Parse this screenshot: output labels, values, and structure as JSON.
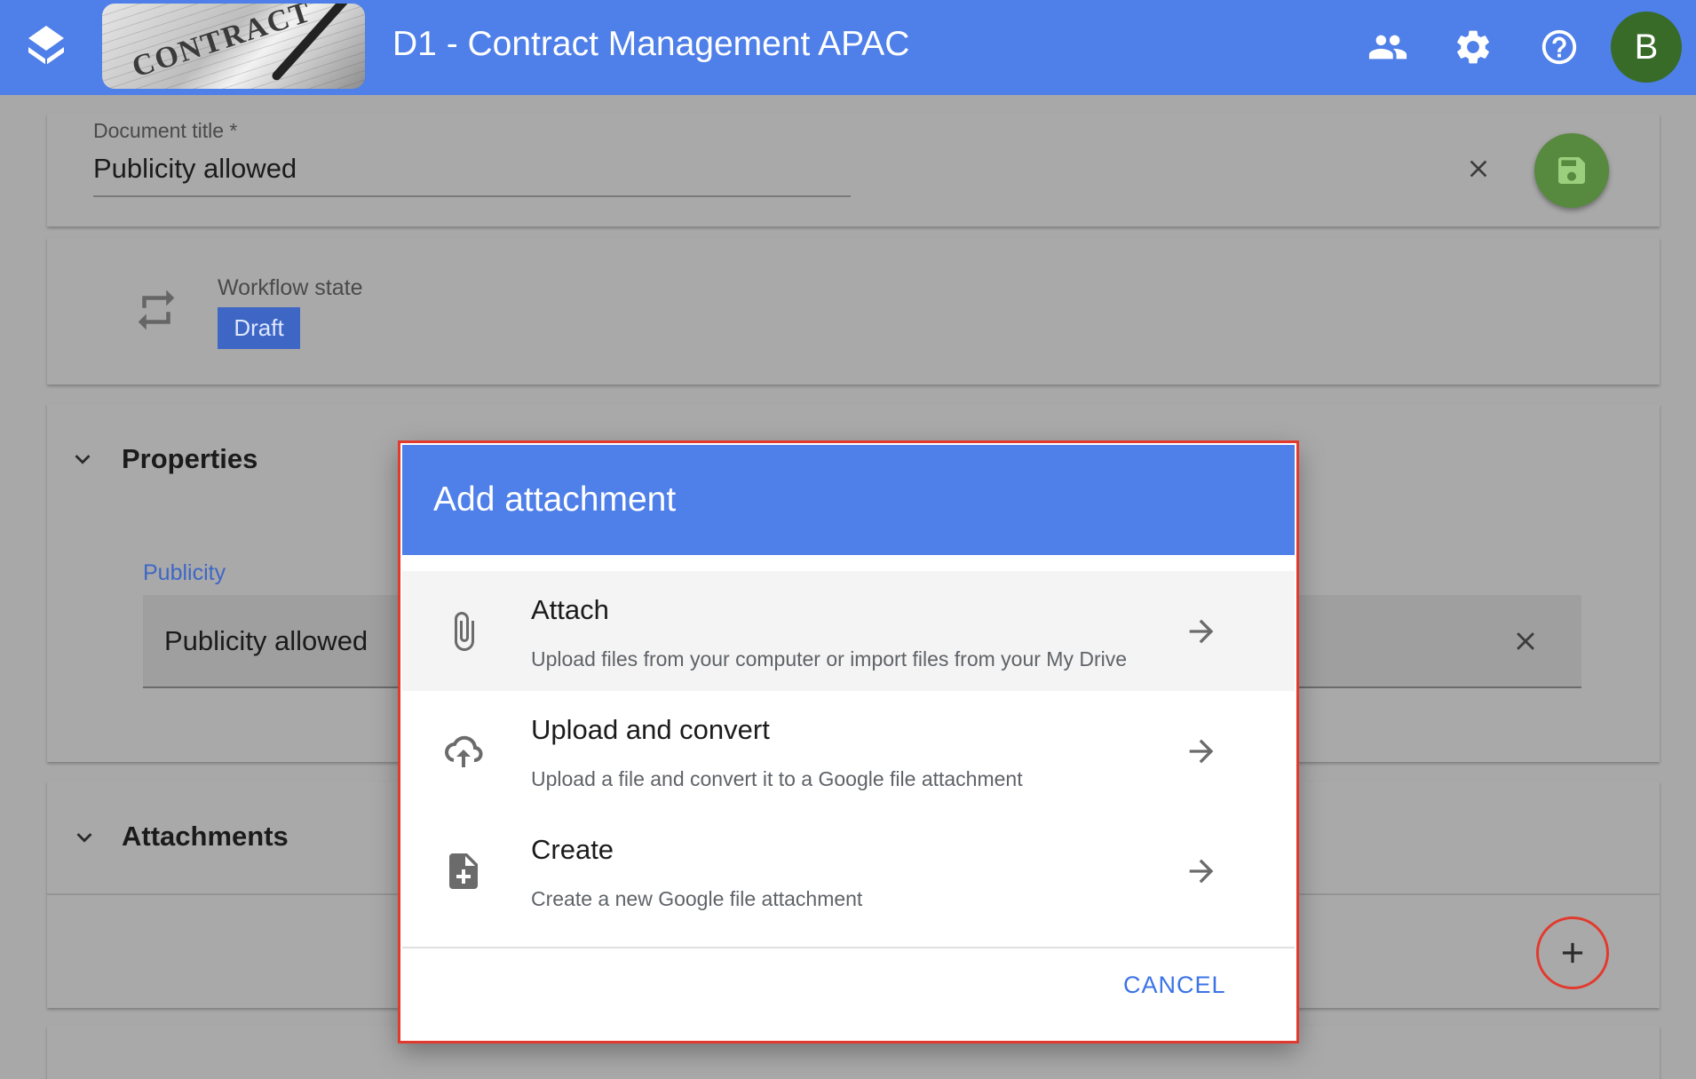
{
  "header": {
    "title": "D1 - Contract Management APAC",
    "banner_text": "CONTRACT",
    "avatar_initial": "B",
    "colors": {
      "bar": "#4f7fe8",
      "avatar": "#386b28"
    }
  },
  "document": {
    "title_label": "Document title *",
    "title_value": "Publicity allowed"
  },
  "workflow": {
    "label": "Workflow state",
    "state": "Draft"
  },
  "properties": {
    "section_title": "Properties",
    "field_label": "Publicity",
    "field_value": "Publicity allowed"
  },
  "attachments": {
    "section_title": "Attachments"
  },
  "dialog": {
    "title": "Add attachment",
    "options": [
      {
        "title": "Attach",
        "description": "Upload files from your computer or import files from your My Drive",
        "icon": "paperclip-icon"
      },
      {
        "title": "Upload and convert",
        "description": "Upload a file and convert it to a Google file attachment",
        "icon": "cloud-upload-icon"
      },
      {
        "title": "Create",
        "description": "Create a new Google file attachment",
        "icon": "file-add-icon"
      }
    ],
    "cancel_label": "CANCEL"
  }
}
